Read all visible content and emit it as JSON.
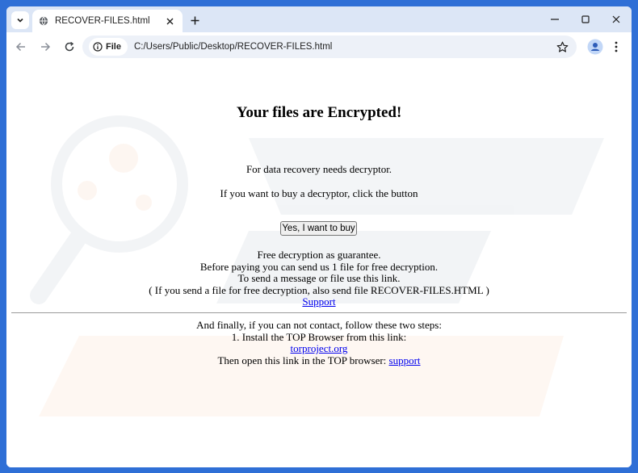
{
  "browser": {
    "tab_title": "RECOVER-FILES.html",
    "omnibox": {
      "chip_label": "File",
      "url": "C:/Users/Public/Desktop/RECOVER-FILES.html"
    }
  },
  "page": {
    "heading": "Your files are Encrypted!",
    "line1": "For data recovery needs decryptor.",
    "line2": "If you want to buy a decryptor, click the button",
    "buy_button_label": "Yes, I want to buy",
    "guarantee": "Free decryption as guarantee.",
    "before_paying": "Before paying you can send us 1 file for free decryption.",
    "send_message": "To send a message or file use this link.",
    "also_send": "( If you send a file for free decryption, also send file RECOVER-FILES.HTML )",
    "support_link": "Support",
    "finally": "And finally, if you can not contact, follow these two steps:",
    "step1": "1. Install the TOP Browser from this link:",
    "tor_link": "torproject.org",
    "then_open": "Then open this link in the TOP browser:",
    "support_link2": "support"
  },
  "colors": {
    "frame_blue": "#2f6fd6",
    "link": "#0000ee"
  }
}
